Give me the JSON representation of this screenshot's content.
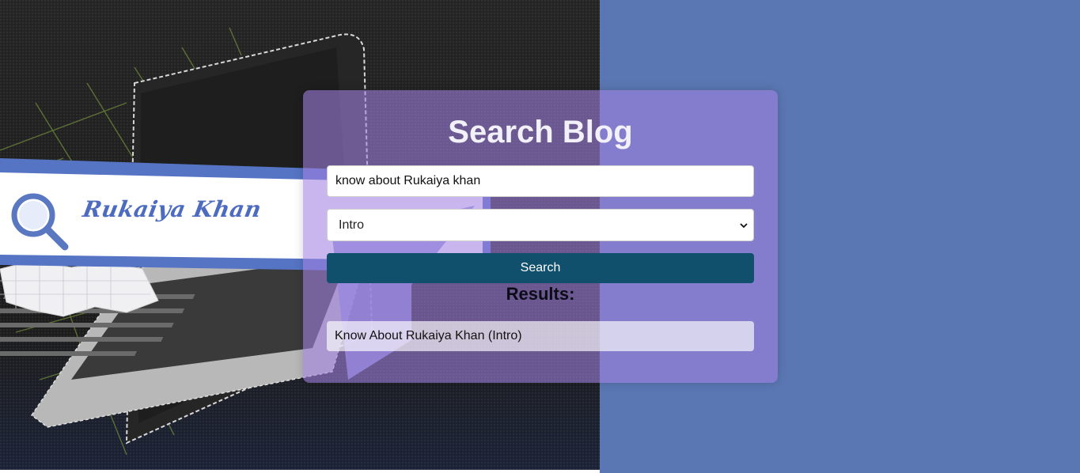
{
  "background": {
    "banner_logo_text": "Rukaiya Khan",
    "left_color": "#1f1f1f",
    "right_color": "#5b77b3"
  },
  "card": {
    "title": "Search Blog",
    "search_input": {
      "value": "know about Rukaiya khan",
      "placeholder": ""
    },
    "category_select": {
      "selected": "Intro",
      "options": [
        "Intro"
      ]
    },
    "search_button_label": "Search",
    "results_title": "Results:",
    "results": [
      "Know About Rukaiya Khan (Intro)"
    ],
    "accent_color": "#11506d"
  }
}
